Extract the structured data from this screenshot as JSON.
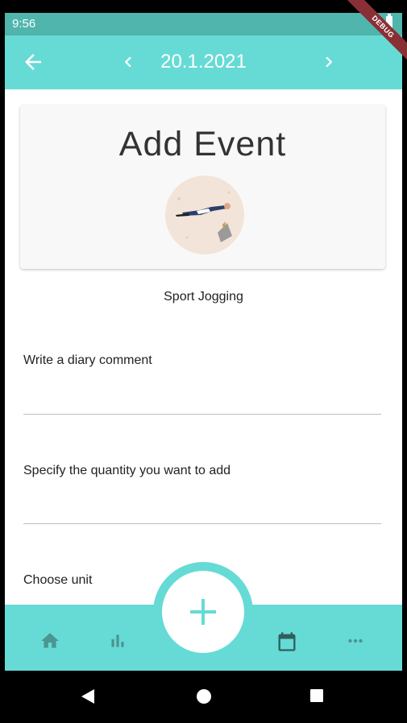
{
  "status_bar": {
    "time": "9:56",
    "battery_icon": "battery-full-icon"
  },
  "debug_banner": "DEBUG",
  "app_bar": {
    "date": "20.1.2021",
    "back_icon": "arrow-back-icon",
    "prev_icon": "chevron-left-icon",
    "next_icon": "chevron-right-icon"
  },
  "card": {
    "title": "Add Event",
    "illustration": "jogging-illustration"
  },
  "event_name": "Sport Jogging",
  "form": {
    "comment_label": "Write a diary comment",
    "comment_value": "",
    "quantity_label": "Specify the quantity you want to add",
    "quantity_value": "",
    "unit_label": "Choose unit"
  },
  "bottom_nav": {
    "items": [
      "home-icon",
      "bar-chart-icon",
      "calendar-icon",
      "more-horiz-icon"
    ],
    "fab_icon": "add-icon"
  },
  "colors": {
    "accent": "#66dbd5",
    "status_bar": "#4fb5ad",
    "debug": "#8a2f36"
  }
}
